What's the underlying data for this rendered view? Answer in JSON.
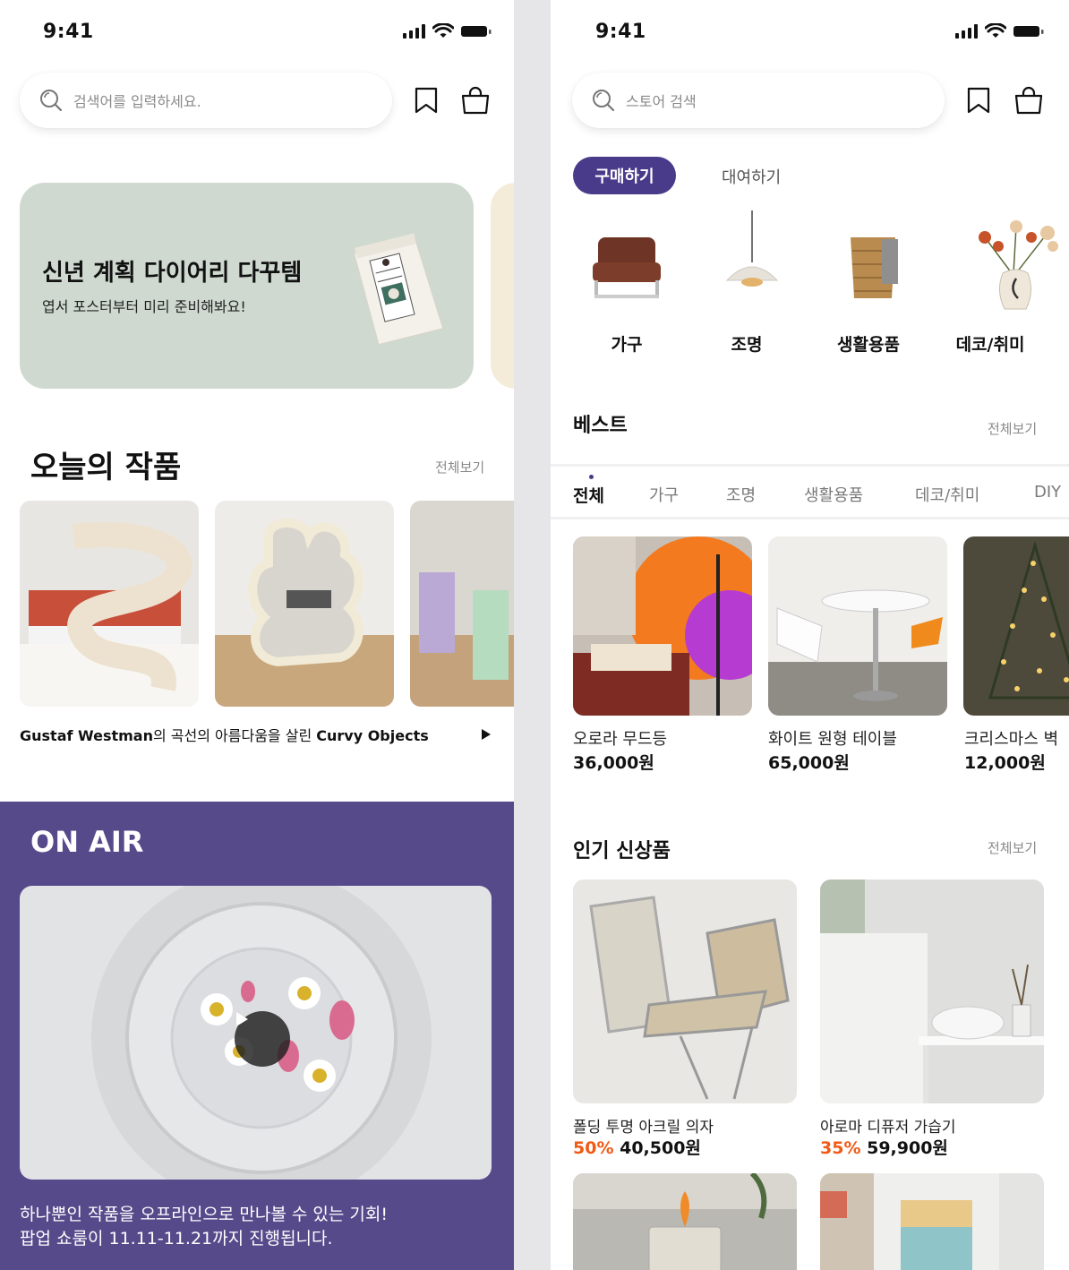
{
  "left": {
    "status": {
      "time": "9:41"
    },
    "search": {
      "placeholder": "검색어를 입력하세요.",
      "icons": [
        "search-icon",
        "bookmark-icon",
        "shopping-bag-icon"
      ]
    },
    "banner": {
      "title": "신년 계획 다이어리 다꾸템",
      "subtitle": "엽서 포스터부터 미리 준비해봐요!",
      "bg": "#cfd9d0"
    },
    "todays_works": {
      "title": "오늘의 작품",
      "see_all": "전체보기",
      "caption_brand": "Gustaf Westman",
      "caption_mid": "의 곡선의 아름다움을 살린 ",
      "caption_end": "Curvy Objects"
    },
    "on_air": {
      "title": "ON AIR",
      "bg": "#574a8b",
      "desc_line1": "하나뿐인 작품을 오프라인으로 만나볼 수 있는 기회!",
      "desc_line2": "팝업 쇼룸이 11.11-11.21까지 진행됩니다."
    }
  },
  "right": {
    "status": {
      "time": "9:41"
    },
    "search": {
      "placeholder": "스토어 검색"
    },
    "mode_tabs": {
      "buy": "구매하기",
      "rent": "대여하기",
      "accent": "#4a3a8a"
    },
    "categories": [
      {
        "label": "가구",
        "icon": "armchair-image"
      },
      {
        "label": "조명",
        "icon": "pendant-lamp-image"
      },
      {
        "label": "생활용품",
        "icon": "basket-image"
      },
      {
        "label": "데코/취미",
        "icon": "flower-vase-image"
      }
    ],
    "best": {
      "title": "베스트",
      "see_all": "전체보기",
      "filters": [
        "전체",
        "가구",
        "조명",
        "생활용품",
        "데코/취미",
        "DIY"
      ],
      "products": [
        {
          "name": "오로라 무드등",
          "price": "36,000원"
        },
        {
          "name": "화이트 원형 테이블",
          "price": "65,000원"
        },
        {
          "name": "크리스마스 벽",
          "price": "12,000원"
        }
      ]
    },
    "new_arrivals": {
      "title": "인기 신상품",
      "see_all": "전체보기",
      "products": [
        {
          "name": "폴딩 투명 아크릴 의자",
          "discount": "50%",
          "price": "40,500원"
        },
        {
          "name": "아로마 디퓨저 가습기",
          "discount": "35%",
          "price": "59,900원"
        }
      ],
      "discount_color": "#f05a14"
    }
  }
}
